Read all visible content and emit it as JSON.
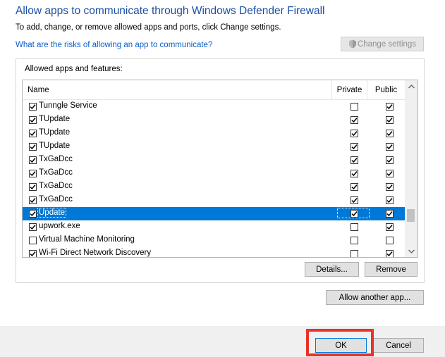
{
  "header": {
    "title": "Allow apps to communicate through Windows Defender Firewall",
    "subtitle": "To add, change, or remove allowed apps and ports, click Change settings.",
    "risks_link": "What are the risks of allowing an app to communicate?",
    "change_settings_label": "Change settings"
  },
  "list": {
    "group_label": "Allowed apps and features:",
    "columns": {
      "name": "Name",
      "private": "Private",
      "public": "Public"
    },
    "rows": [
      {
        "name": "Tunngle Service",
        "enabled": true,
        "private": false,
        "public": true,
        "selected": false
      },
      {
        "name": "TUpdate",
        "enabled": true,
        "private": true,
        "public": true,
        "selected": false
      },
      {
        "name": "TUpdate",
        "enabled": true,
        "private": true,
        "public": true,
        "selected": false
      },
      {
        "name": "TUpdate",
        "enabled": true,
        "private": true,
        "public": true,
        "selected": false
      },
      {
        "name": "TxGaDcc",
        "enabled": true,
        "private": true,
        "public": true,
        "selected": false
      },
      {
        "name": "TxGaDcc",
        "enabled": true,
        "private": true,
        "public": true,
        "selected": false
      },
      {
        "name": "TxGaDcc",
        "enabled": true,
        "private": true,
        "public": true,
        "selected": false
      },
      {
        "name": "TxGaDcc",
        "enabled": true,
        "private": true,
        "public": true,
        "selected": false
      },
      {
        "name": "Update",
        "enabled": true,
        "private": true,
        "public": true,
        "selected": true
      },
      {
        "name": "upwork.exe",
        "enabled": true,
        "private": false,
        "public": true,
        "selected": false
      },
      {
        "name": "Virtual Machine Monitoring",
        "enabled": false,
        "private": false,
        "public": false,
        "selected": false
      },
      {
        "name": "Wi-Fi Direct Network Discovery",
        "enabled": true,
        "private": false,
        "public": true,
        "selected": false
      }
    ]
  },
  "buttons": {
    "details": "Details...",
    "remove": "Remove",
    "allow_another": "Allow another app...",
    "ok": "OK",
    "cancel": "Cancel"
  },
  "colors": {
    "title": "#1a4fa3",
    "link": "#0b5ec6",
    "selection": "#0078d7",
    "highlight": "#e8322a"
  }
}
